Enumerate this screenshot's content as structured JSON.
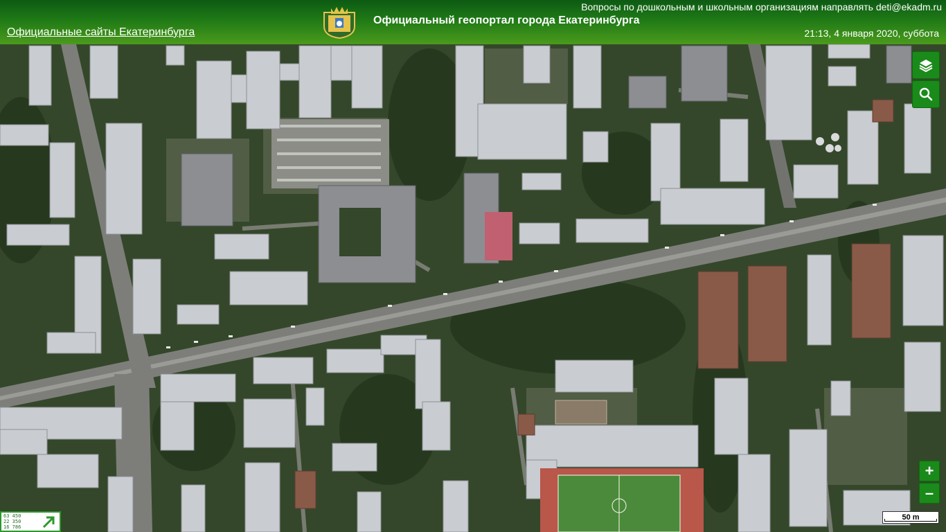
{
  "header": {
    "sites_link": "Официальные сайты Екатеринбурга",
    "title": "Официальный геопортал города Екатеринбурга",
    "contact": "Вопросы по дошкольным и школьным организациям направлять deti@ekadm.ru",
    "datetime": "21:13, 4 января 2020, суббота"
  },
  "controls": {
    "layers_icon": "layers-icon",
    "search_icon": "search-icon",
    "zoom_in": "+",
    "zoom_out": "–"
  },
  "scale": {
    "label": "50 m"
  },
  "minimap": {
    "coords": [
      "63 450",
      "22 350",
      "16 786"
    ]
  },
  "colors": {
    "header_dark": "#0d5a14",
    "header_light": "#4b9a1c",
    "control": "#1a8a1a"
  }
}
